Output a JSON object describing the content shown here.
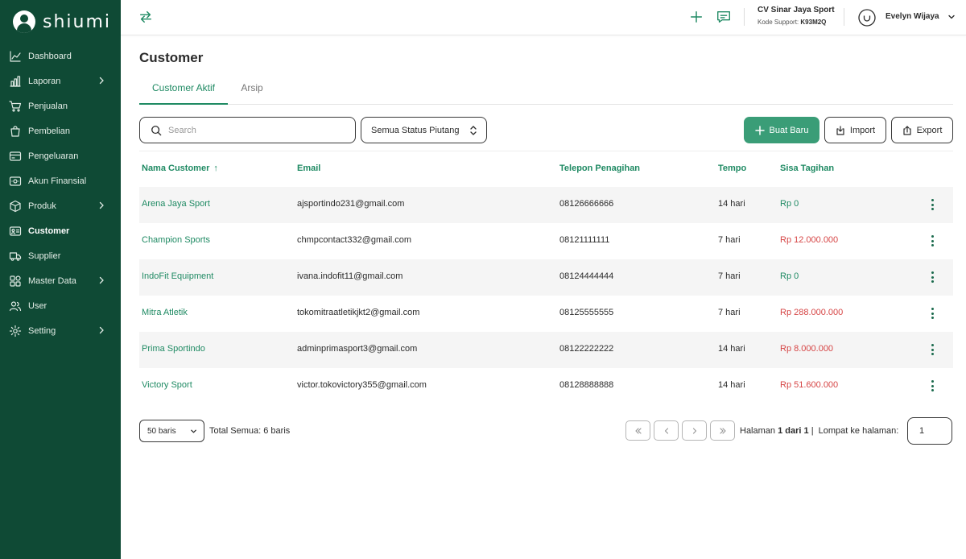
{
  "app": {
    "logo_text": "shiumi",
    "brand_color": "#0f4a35",
    "accent_color": "#1f8a63",
    "danger_color": "#d64545"
  },
  "sidebar": {
    "items": [
      {
        "label": "Dashboard",
        "icon": "chart-line-icon",
        "has_submenu": false,
        "active": false
      },
      {
        "label": "Laporan",
        "icon": "bar-chart-icon",
        "has_submenu": true,
        "active": false
      },
      {
        "label": "Penjualan",
        "icon": "cart-icon",
        "has_submenu": false,
        "active": false
      },
      {
        "label": "Pembelian",
        "icon": "shopping-bag-icon",
        "has_submenu": false,
        "active": false
      },
      {
        "label": "Pengeluaran",
        "icon": "credit-card-icon",
        "has_submenu": false,
        "active": false
      },
      {
        "label": "Akun Finansial",
        "icon": "money-icon",
        "has_submenu": false,
        "active": false
      },
      {
        "label": "Produk",
        "icon": "box-icon",
        "has_submenu": true,
        "active": false
      },
      {
        "label": "Customer",
        "icon": "contact-card-icon",
        "has_submenu": false,
        "active": true
      },
      {
        "label": "Supplier",
        "icon": "truck-icon",
        "has_submenu": false,
        "active": false
      },
      {
        "label": "Master Data",
        "icon": "grid-icon",
        "has_submenu": true,
        "active": false
      },
      {
        "label": "User",
        "icon": "users-icon",
        "has_submenu": false,
        "active": false
      },
      {
        "label": "Setting",
        "icon": "gear-icon",
        "has_submenu": true,
        "active": false
      }
    ]
  },
  "header": {
    "company_name": "CV Sinar Jaya Sport",
    "support_label": "Kode Support:",
    "support_code": "K93M2Q",
    "user_name": "Evelyn Wijaya"
  },
  "page": {
    "title": "Customer",
    "tabs": [
      {
        "label": "Customer Aktif",
        "active": true
      },
      {
        "label": "Arsip",
        "active": false
      }
    ]
  },
  "toolbar": {
    "search_placeholder": "Search",
    "status_filter": "Semua Status Piutang",
    "create_label": "Buat Baru",
    "import_label": "Import",
    "export_label": "Export"
  },
  "table": {
    "columns": [
      "Nama Customer",
      "Email",
      "Telepon Penagihan",
      "Tempo",
      "Sisa Tagihan"
    ],
    "sort_indicator": "↑",
    "rows": [
      {
        "name": "Arena Jaya Sport",
        "email": "ajsportindo231@gmail.com",
        "phone": "08126666666",
        "tempo": "14 hari",
        "balance": "Rp 0",
        "status": "zero"
      },
      {
        "name": "Champion Sports",
        "email": "chmpcontact332@gmail.com",
        "phone": "08121111111",
        "tempo": "7 hari",
        "balance": "Rp 12.000.000",
        "status": "due"
      },
      {
        "name": "IndoFit Equipment",
        "email": "ivana.indofit11@gmail.com",
        "phone": "08124444444",
        "tempo": "7 hari",
        "balance": "Rp 0",
        "status": "zero"
      },
      {
        "name": "Mitra Atletik",
        "email": "tokomitraatletikjkt2@gmail.com",
        "phone": "08125555555",
        "tempo": "7 hari",
        "balance": "Rp 288.000.000",
        "status": "due"
      },
      {
        "name": "Prima Sportindo",
        "email": "adminprimasport3@gmail.com",
        "phone": "08122222222",
        "tempo": "14 hari",
        "balance": "Rp 8.000.000",
        "status": "due"
      },
      {
        "name": "Victory Sport",
        "email": "victor.tokovictory355@gmail.com",
        "phone": "08128888888",
        "tempo": "14 hari",
        "balance": "Rp 51.600.000",
        "status": "due"
      }
    ]
  },
  "pagination": {
    "rows_per_page": "50 baris",
    "total_label": "Total Semua: 6 baris",
    "page_label": "Halaman",
    "page_value": "1 dari 1",
    "jump_label": "|  Lompat ke halaman:",
    "jump_value": "1"
  }
}
